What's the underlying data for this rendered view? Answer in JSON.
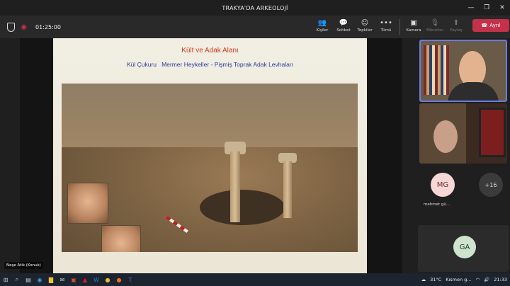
{
  "window": {
    "title": "TRAKYA'DA ARKEOLOJİ"
  },
  "toolbar": {
    "timer": "01:25:00",
    "buttons": [
      {
        "label": "Kişiler",
        "icon": "people-icon"
      },
      {
        "label": "Sohbet",
        "icon": "chat-icon"
      },
      {
        "label": "Tepkiler",
        "icon": "reactions-icon"
      },
      {
        "label": "Tümü",
        "icon": "more-icon"
      },
      {
        "label": "Kamera",
        "icon": "camera-icon"
      },
      {
        "label": "Mikrofon",
        "icon": "mic-icon"
      },
      {
        "label": "Paylaş",
        "icon": "share-icon"
      }
    ],
    "leave_label": "Ayrıl"
  },
  "slide": {
    "title": "Kült ve Adak Alanı",
    "subtitle": "Kül Çukuru   Mermer Heykeller - Pişmiş Toprak Adak Levhaları"
  },
  "presenter": {
    "name": "Neşe Atik (Konuk)"
  },
  "participants": {
    "mg": {
      "initials": "MG",
      "name": "mehmet gü..."
    },
    "more": "+16",
    "ga": {
      "initials": "GA"
    }
  },
  "taskbar": {
    "weather": "31°C",
    "weather_text": "Kısmen g...",
    "time": "21:33"
  }
}
